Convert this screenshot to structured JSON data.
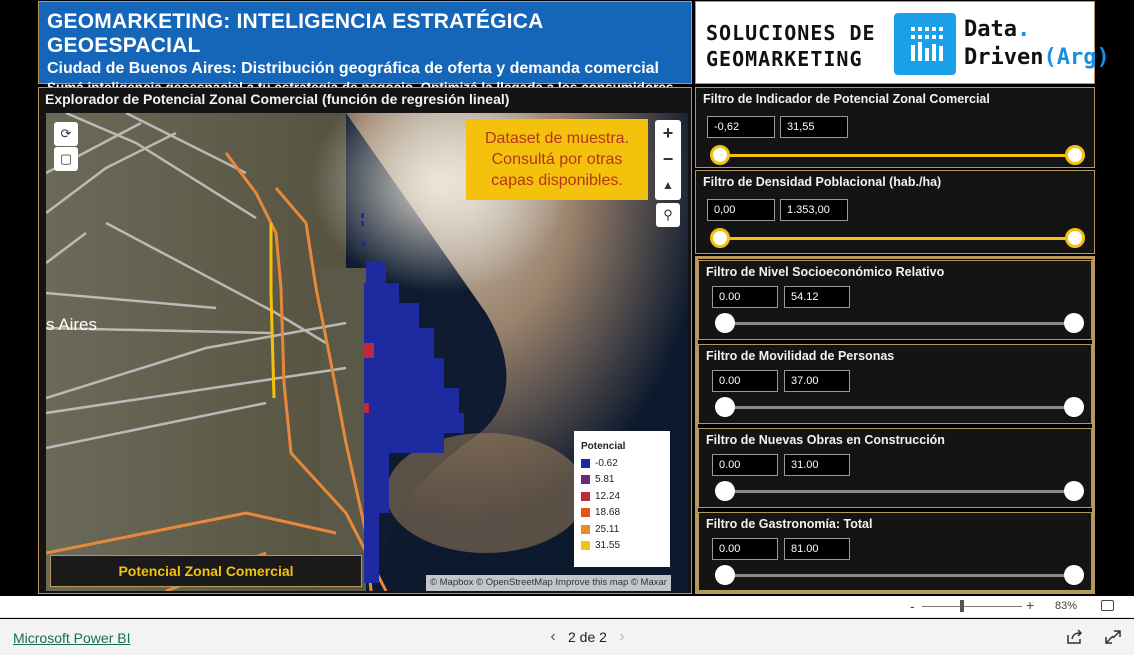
{
  "header": {
    "title": "GEOMARKETING: INTELIGENCIA ESTRATÉGICA GEOESPACIAL",
    "subtitle": "Ciudad de Buenos Aires: Distribución geográfica de oferta y demanda comercial",
    "tagline": "Sumá inteligencia geoespacial a tu estrategia de negocio. Optimizá la llegada a los consumidores."
  },
  "brand": {
    "solutions_line1": "SOLUCIONES DE",
    "solutions_line2": "GEOMARKETING",
    "name_line1": "Data",
    "name_dot": ".",
    "name_line2a": "Driven",
    "name_line2b": "(Arg)",
    "icon": "bar-chart-icon"
  },
  "map": {
    "title": "Explorador de Potencial Zonal Comercial (función de regresión lineal)",
    "place_label": "s Aires",
    "dataset_note_line1": "Dataset de muestra.",
    "dataset_note_line2": "Consultá por otras",
    "dataset_note_line3": "capas disponibles.",
    "zoom_in": "+",
    "zoom_out": "−",
    "legend": {
      "title": "Potencial",
      "items": [
        {
          "label": "-0.62",
          "color": "#1e2aa0"
        },
        {
          "label": "5.81",
          "color": "#6e2a7a"
        },
        {
          "label": "12.24",
          "color": "#c0283c"
        },
        {
          "label": "18.68",
          "color": "#e8501e"
        },
        {
          "label": "25.11",
          "color": "#f08a1e"
        },
        {
          "label": "31.55",
          "color": "#f4c20d"
        }
      ]
    },
    "layer_button": "Potencial Zonal Comercial",
    "attribution": "© Mapbox © OpenStreetMap  Improve this map  © Maxar"
  },
  "filters": [
    {
      "title": "Filtro de Indicador de Potencial Zonal Comercial",
      "min": "-0,62",
      "max": "31,55"
    },
    {
      "title": "Filtro de Densidad Poblacional (hab./ha)",
      "min": "0,00",
      "max": "1.353,00"
    },
    {
      "title": "Filtro de Nivel Socioeconómico Relativo",
      "min": "0.00",
      "max": "54.12"
    },
    {
      "title": "Filtro de Movilidad de Personas",
      "min": "0.00",
      "max": "37.00"
    },
    {
      "title": "Filtro de Nuevas Obras en Construcción",
      "min": "0.00",
      "max": "31.00"
    },
    {
      "title": "Filtro de Gastronomía: Total",
      "min": "0.00",
      "max": "81.00"
    }
  ],
  "zoombar": {
    "minus": "-",
    "plus": "+",
    "percent": "83%"
  },
  "footer": {
    "app_link": "Microsoft Power BI",
    "page": "2 de 2",
    "prev": "‹",
    "next": "›"
  },
  "colors": {
    "accent_yellow": "#f4c20d",
    "header_blue": "#1565b8",
    "gold_border": "#b9975b"
  }
}
